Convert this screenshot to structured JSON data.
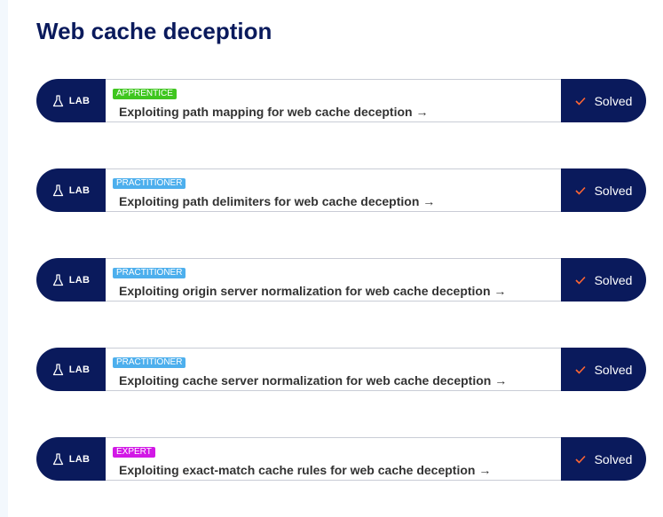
{
  "page": {
    "title": "Web cache deception"
  },
  "colors": {
    "navy": "#0a1a5c",
    "apprentice": "#3fc61f",
    "practitioner": "#4dafed",
    "expert": "#d218e6",
    "check": "#ff6633"
  },
  "labs": [
    {
      "badge": "LAB",
      "level": "APPRENTICE",
      "title": "Exploiting path mapping for web cache deception →",
      "status": "Solved"
    },
    {
      "badge": "LAB",
      "level": "PRACTITIONER",
      "title": "Exploiting path delimiters for web cache deception →",
      "status": "Solved"
    },
    {
      "badge": "LAB",
      "level": "PRACTITIONER",
      "title": "Exploiting origin server normalization for web cache deception →",
      "status": "Solved"
    },
    {
      "badge": "LAB",
      "level": "PRACTITIONER",
      "title": "Exploiting cache server normalization for web cache deception →",
      "status": "Solved"
    },
    {
      "badge": "LAB",
      "level": "EXPERT",
      "title": "Exploiting exact-match cache rules for web cache deception →",
      "status": "Solved"
    }
  ]
}
